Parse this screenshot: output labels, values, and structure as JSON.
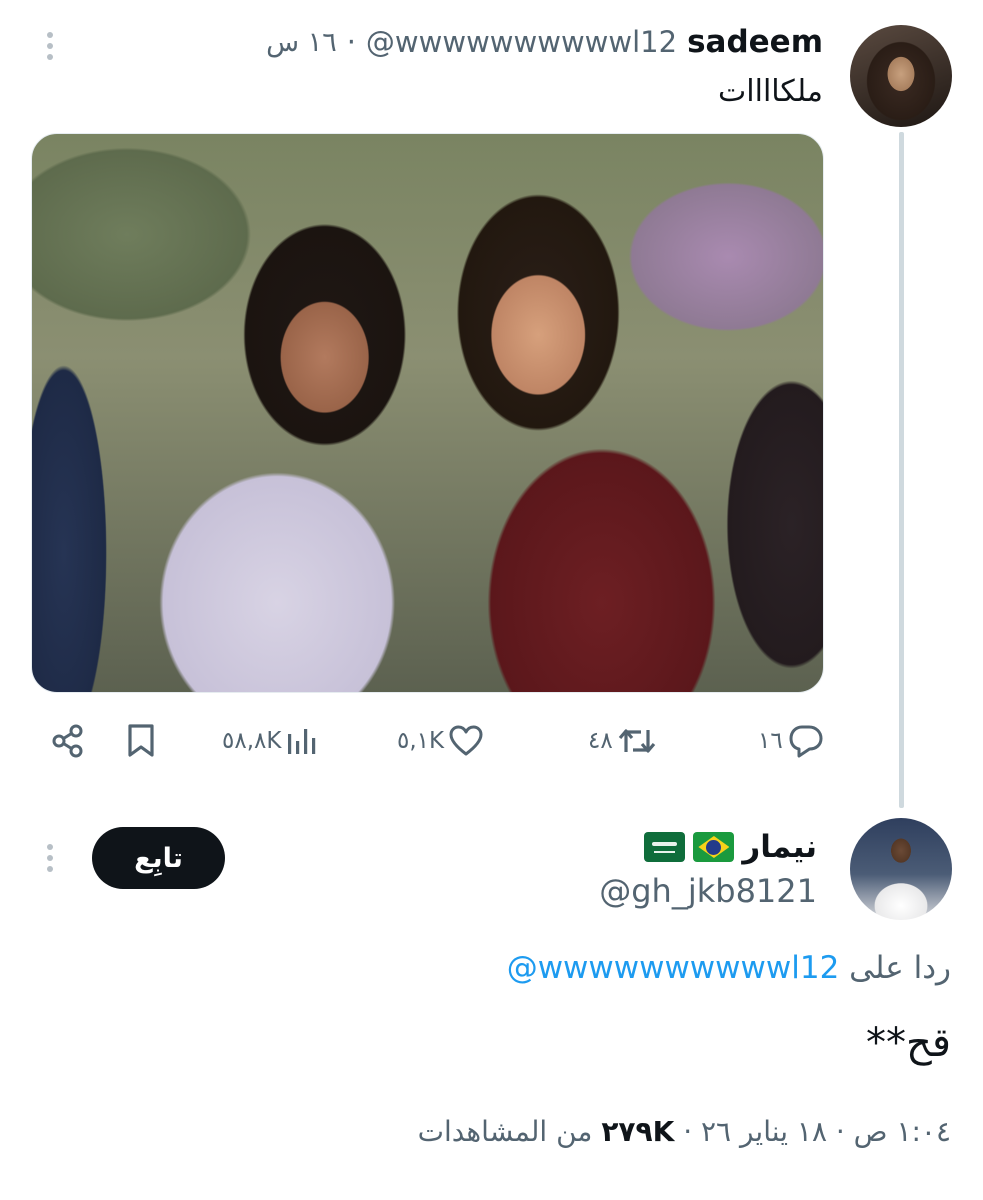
{
  "parent_tweet": {
    "display_name": "sadeem",
    "handle": "@wwwwwwwwwwl12",
    "separator": "·",
    "time": "١٦ س",
    "text": "ملكاااات",
    "stats": {
      "replies": "١٦",
      "retweets": "٤٨",
      "likes": "٥,١K",
      "views": "٥٨,٨K"
    }
  },
  "reply_tweet": {
    "display_name": "نيمار",
    "handle": "@gh_jkb8121",
    "follow_label": "تابِع",
    "replying_to_label": "ردا على",
    "replying_to_handle": "@wwwwwwwwwwl12",
    "text": "قح**",
    "timestamp": "١:٠٤ ص · ١٨ يناير ٢٦ ·",
    "views_count": "٢٧٩K",
    "views_label": "من المشاهدات"
  },
  "icons": {
    "more": "more-dots-icon",
    "share": "share-icon",
    "bookmark": "bookmark-icon",
    "views": "views-icon",
    "like": "heart-icon",
    "retweet": "retweet-icon",
    "reply": "reply-icon",
    "flags": [
      "brazil-flag-icon",
      "saudi-flag-icon"
    ]
  },
  "colors": {
    "text_primary": "#0f1419",
    "text_secondary": "#536471",
    "link": "#1d9bf0",
    "follow_button": "#0f1419"
  }
}
